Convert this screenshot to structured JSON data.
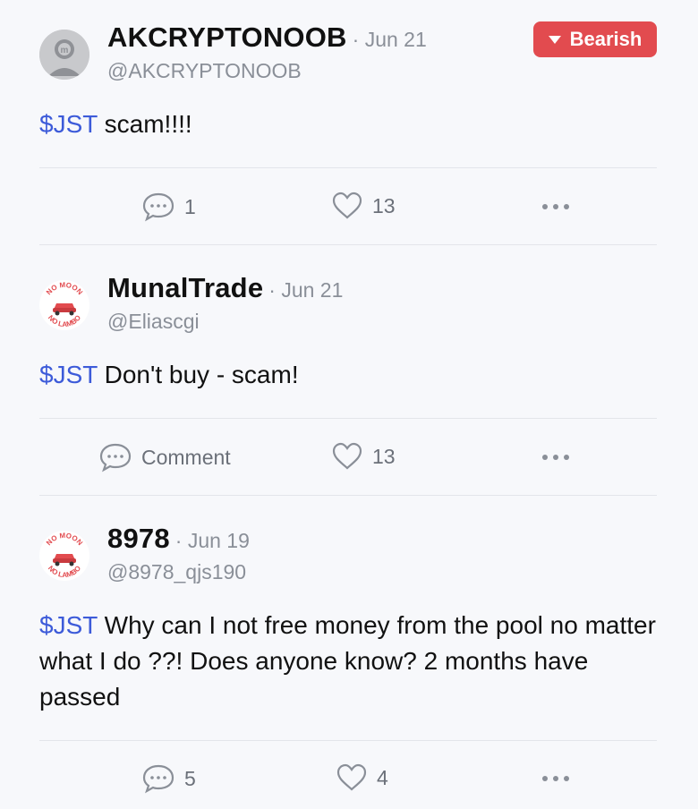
{
  "posts": [
    {
      "name": "AKCRYPTONOOB",
      "date": "· Jun 21",
      "handle": "@AKCRYPTONOOB",
      "ticker": "$JST",
      "text": " scam!!!!",
      "badge": "Bearish",
      "avatar": "coin-logo-avatar",
      "comment_label": "1",
      "like_count": "13"
    },
    {
      "name": "MunalTrade",
      "date": "· Jun 21",
      "handle": "@Eliascgi",
      "ticker": "$JST",
      "text": " Don't buy - scam!",
      "avatar": "no-moon-no-lambo-avatar",
      "avatar_text_top": "NO MOON",
      "avatar_text_bottom": "NO LAMBO",
      "comment_label": "Comment",
      "like_count": "13"
    },
    {
      "name": "8978",
      "date": "· Jun 19",
      "handle": "@8978_qjs190",
      "ticker": "$JST",
      "text": " Why can I not free money from the pool no matter what I do ??! Does anyone know? 2 months have passed",
      "avatar": "no-moon-no-lambo-avatar",
      "avatar_text_top": "NO MOON",
      "avatar_text_bottom": "NO LAMBO",
      "comment_label": "5",
      "like_count": "4"
    }
  ],
  "colors": {
    "ticker": "#3d5bd9",
    "bearish": "#e24b4f",
    "muted": "#8a8f98",
    "background": "#f7f8fb"
  }
}
